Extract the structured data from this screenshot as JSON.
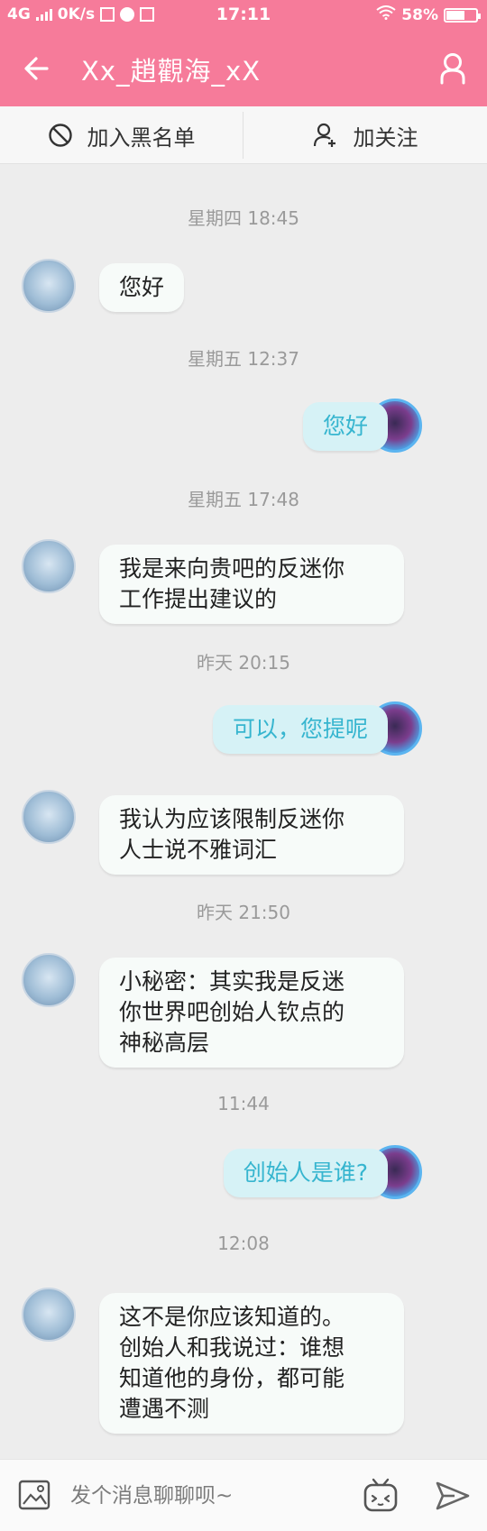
{
  "status_bar": {
    "network": "4G",
    "speed": "0K/s",
    "time": "17:11",
    "battery": "58%"
  },
  "header": {
    "title": "Xx_趙觀海_xX",
    "back_icon": "arrow-left-icon",
    "profile_icon": "person-icon"
  },
  "actions": {
    "block_label": "加入黑名单",
    "follow_label": "加关注"
  },
  "messages": [
    {
      "ts": "星期四 18:45",
      "from": "other",
      "lines": [
        "您好"
      ]
    },
    {
      "ts": "星期五 12:37",
      "from": "self",
      "lines": [
        "您好"
      ]
    },
    {
      "ts": "星期五 17:48",
      "from": "other",
      "lines": [
        "我是来向贵吧的反迷你",
        "工作提出建议的"
      ]
    },
    {
      "ts": "昨天 20:15",
      "from": "self",
      "lines": [
        "可以，您提呢"
      ]
    },
    {
      "ts": "",
      "from": "other",
      "lines": [
        "我认为应该限制反迷你",
        "人士说不雅词汇"
      ]
    },
    {
      "ts": "昨天 21:50",
      "from": "other",
      "lines": [
        "小秘密：其实我是反迷",
        "你世界吧创始人钦点的",
        "神秘高层"
      ]
    },
    {
      "ts": "11:44",
      "from": "self",
      "lines": [
        "创始人是谁?"
      ]
    },
    {
      "ts": "12:08",
      "from": "other",
      "lines": [
        "这不是你应该知道的。",
        "创始人和我说过：谁想",
        "知道他的身份，都可能",
        "遭遇不测"
      ]
    }
  ],
  "input": {
    "placeholder": "发个消息聊聊呗~"
  },
  "colors": {
    "header": "#f67b9a",
    "self_bubble": "#d6f2f6",
    "self_text": "#36b5cf",
    "background": "#ededed"
  }
}
